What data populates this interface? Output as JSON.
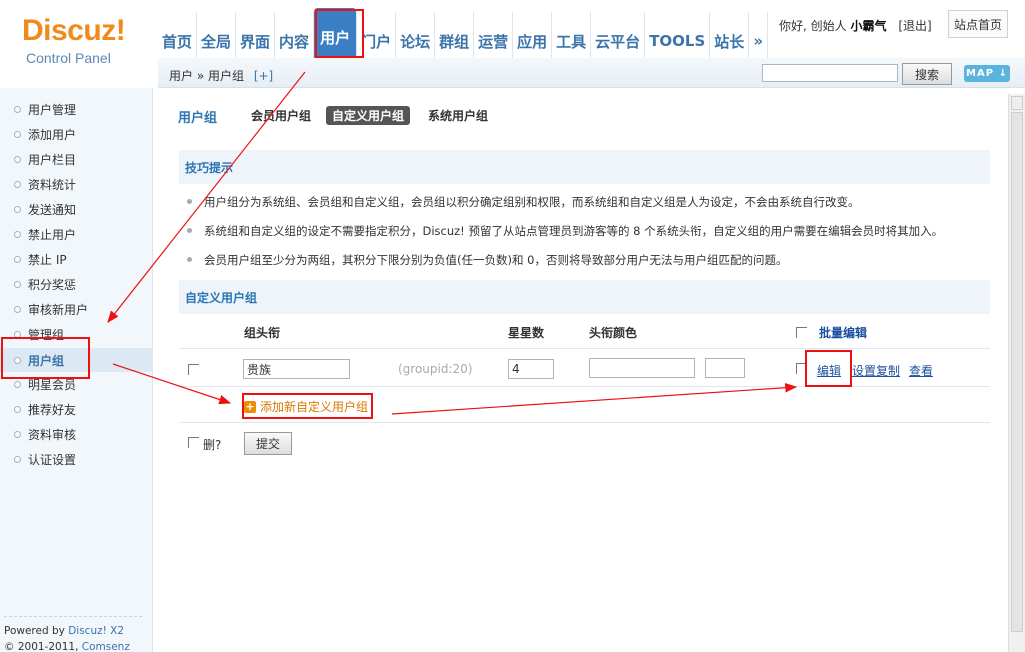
{
  "logo": {
    "name": "Discuz!",
    "subtitle": "Control Panel"
  },
  "topnav": [
    {
      "label": "首页"
    },
    {
      "label": "全局"
    },
    {
      "label": "界面"
    },
    {
      "label": "内容"
    },
    {
      "label": "用户",
      "active": true
    },
    {
      "label": "门户"
    },
    {
      "label": "论坛"
    },
    {
      "label": "群组"
    },
    {
      "label": "运营"
    },
    {
      "label": "应用"
    },
    {
      "label": "工具"
    },
    {
      "label": "云平台"
    },
    {
      "label": "TOOLS"
    },
    {
      "label": "站长"
    },
    {
      "label": "»"
    }
  ],
  "user": {
    "greeting": "你好, 创始人",
    "name": "小霸气",
    "logout": "[退出]"
  },
  "site_home": "站点首页",
  "breadcrumb": {
    "path": "用户 » 用户组",
    "add": "[+]"
  },
  "search": {
    "button": "搜索",
    "value": ""
  },
  "map_button": "MAP",
  "sidebar": {
    "items": [
      {
        "label": "用户管理"
      },
      {
        "label": "添加用户"
      },
      {
        "label": "用户栏目"
      },
      {
        "label": "资料统计"
      },
      {
        "label": "发送通知"
      },
      {
        "label": "禁止用户"
      },
      {
        "label": "禁止 IP"
      },
      {
        "label": "积分奖惩"
      },
      {
        "label": "审核新用户"
      },
      {
        "label": "管理组"
      },
      {
        "label": "用户组",
        "active": true
      },
      {
        "label": "明星会员"
      },
      {
        "label": "推荐好友"
      },
      {
        "label": "资料审核"
      },
      {
        "label": "认证设置"
      }
    ],
    "footer": {
      "powered": "Powered by",
      "product": "Discuz! X2",
      "copy": "© 2001-2011,",
      "company": "Comsenz Inc."
    }
  },
  "main": {
    "title": "用户组",
    "tabs": [
      {
        "label": "会员用户组"
      },
      {
        "label": "自定义用户组",
        "active": true
      },
      {
        "label": "系统用户组"
      }
    ],
    "tips_title": "技巧提示",
    "tips": [
      "用户组分为系统组、会员组和自定义组，会员组以积分确定组别和权限，而系统组和自定义组是人为设定，不会由系统自行改变。",
      "系统组和自定义组的设定不需要指定积分，Discuz! 预留了从站点管理员到游客等的 8 个系统头衔，自定义组的用户需要在编辑会员时将其加入。",
      "会员用户组至少分为两组，其积分下限分别为负值(任一负数)和 0，否则将导致部分用户无法与用户组匹配的问题。"
    ],
    "custom_title": "自定义用户组",
    "columns": {
      "name": "组头衔",
      "stars": "星星数",
      "color": "头衔颜色",
      "batch": "批量编辑"
    },
    "row": {
      "name": "贵族",
      "groupid": "(groupid:20)",
      "stars": "4",
      "color": "",
      "edit": "编辑",
      "copy": "设置复制",
      "view": "查看"
    },
    "add_label": "添加新自定义用户组",
    "delete_label": "删?",
    "submit": "提交"
  },
  "colors": {
    "accent": "#3a74ab",
    "nav_active": "#3a7ec4",
    "logo": "#f08a1c",
    "annotation": "#ee1111"
  }
}
